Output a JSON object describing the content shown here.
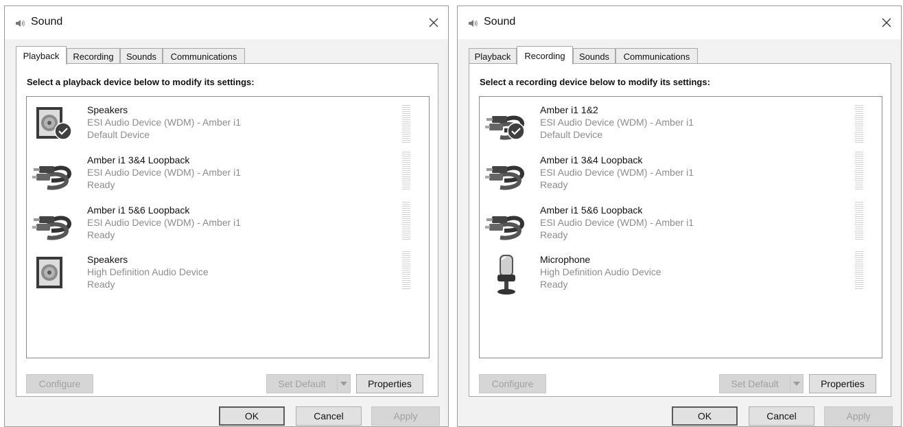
{
  "windows": [
    {
      "title": "Sound",
      "tabs": [
        {
          "label": "Playback",
          "active": true
        },
        {
          "label": "Recording",
          "active": false
        },
        {
          "label": "Sounds",
          "active": false
        },
        {
          "label": "Communications",
          "active": false
        }
      ],
      "instruction": "Select a playback device below to modify its settings:",
      "devices": [
        {
          "name": "Speakers",
          "description": "ESI Audio Device (WDM) - Amber i1",
          "status": "Default Device",
          "icon": "speaker-icon",
          "is_default": true
        },
        {
          "name": "Amber i1 3&4 Loopback",
          "description": "ESI Audio Device (WDM) - Amber i1",
          "status": "Ready",
          "icon": "rca-cable-icon",
          "is_default": false
        },
        {
          "name": "Amber i1 5&6 Loopback",
          "description": "ESI Audio Device (WDM) - Amber i1",
          "status": "Ready",
          "icon": "rca-cable-icon",
          "is_default": false
        },
        {
          "name": "Speakers",
          "description": "High Definition Audio Device",
          "status": "Ready",
          "icon": "speaker-icon",
          "is_default": false
        }
      ],
      "buttons": {
        "configure": "Configure",
        "set_default": "Set Default",
        "properties": "Properties"
      },
      "footer": {
        "ok": "OK",
        "cancel": "Cancel",
        "apply": "Apply"
      }
    },
    {
      "title": "Sound",
      "tabs": [
        {
          "label": "Playback",
          "active": false
        },
        {
          "label": "Recording",
          "active": true
        },
        {
          "label": "Sounds",
          "active": false
        },
        {
          "label": "Communications",
          "active": false
        }
      ],
      "instruction": "Select a recording device below to modify its settings:",
      "devices": [
        {
          "name": "Amber i1 1&2",
          "description": "ESI Audio Device (WDM) - Amber i1",
          "status": "Default Device",
          "icon": "rca-cable-icon",
          "is_default": true
        },
        {
          "name": "Amber i1 3&4 Loopback",
          "description": "ESI Audio Device (WDM) - Amber i1",
          "status": "Ready",
          "icon": "rca-cable-icon",
          "is_default": false
        },
        {
          "name": "Amber i1 5&6 Loopback",
          "description": "ESI Audio Device (WDM) - Amber i1",
          "status": "Ready",
          "icon": "rca-cable-icon",
          "is_default": false
        },
        {
          "name": "Microphone",
          "description": "High Definition Audio Device",
          "status": "Ready",
          "icon": "microphone-icon",
          "is_default": false
        }
      ],
      "buttons": {
        "configure": "Configure",
        "set_default": "Set Default",
        "properties": "Properties"
      },
      "footer": {
        "ok": "OK",
        "cancel": "Cancel",
        "apply": "Apply"
      }
    }
  ]
}
